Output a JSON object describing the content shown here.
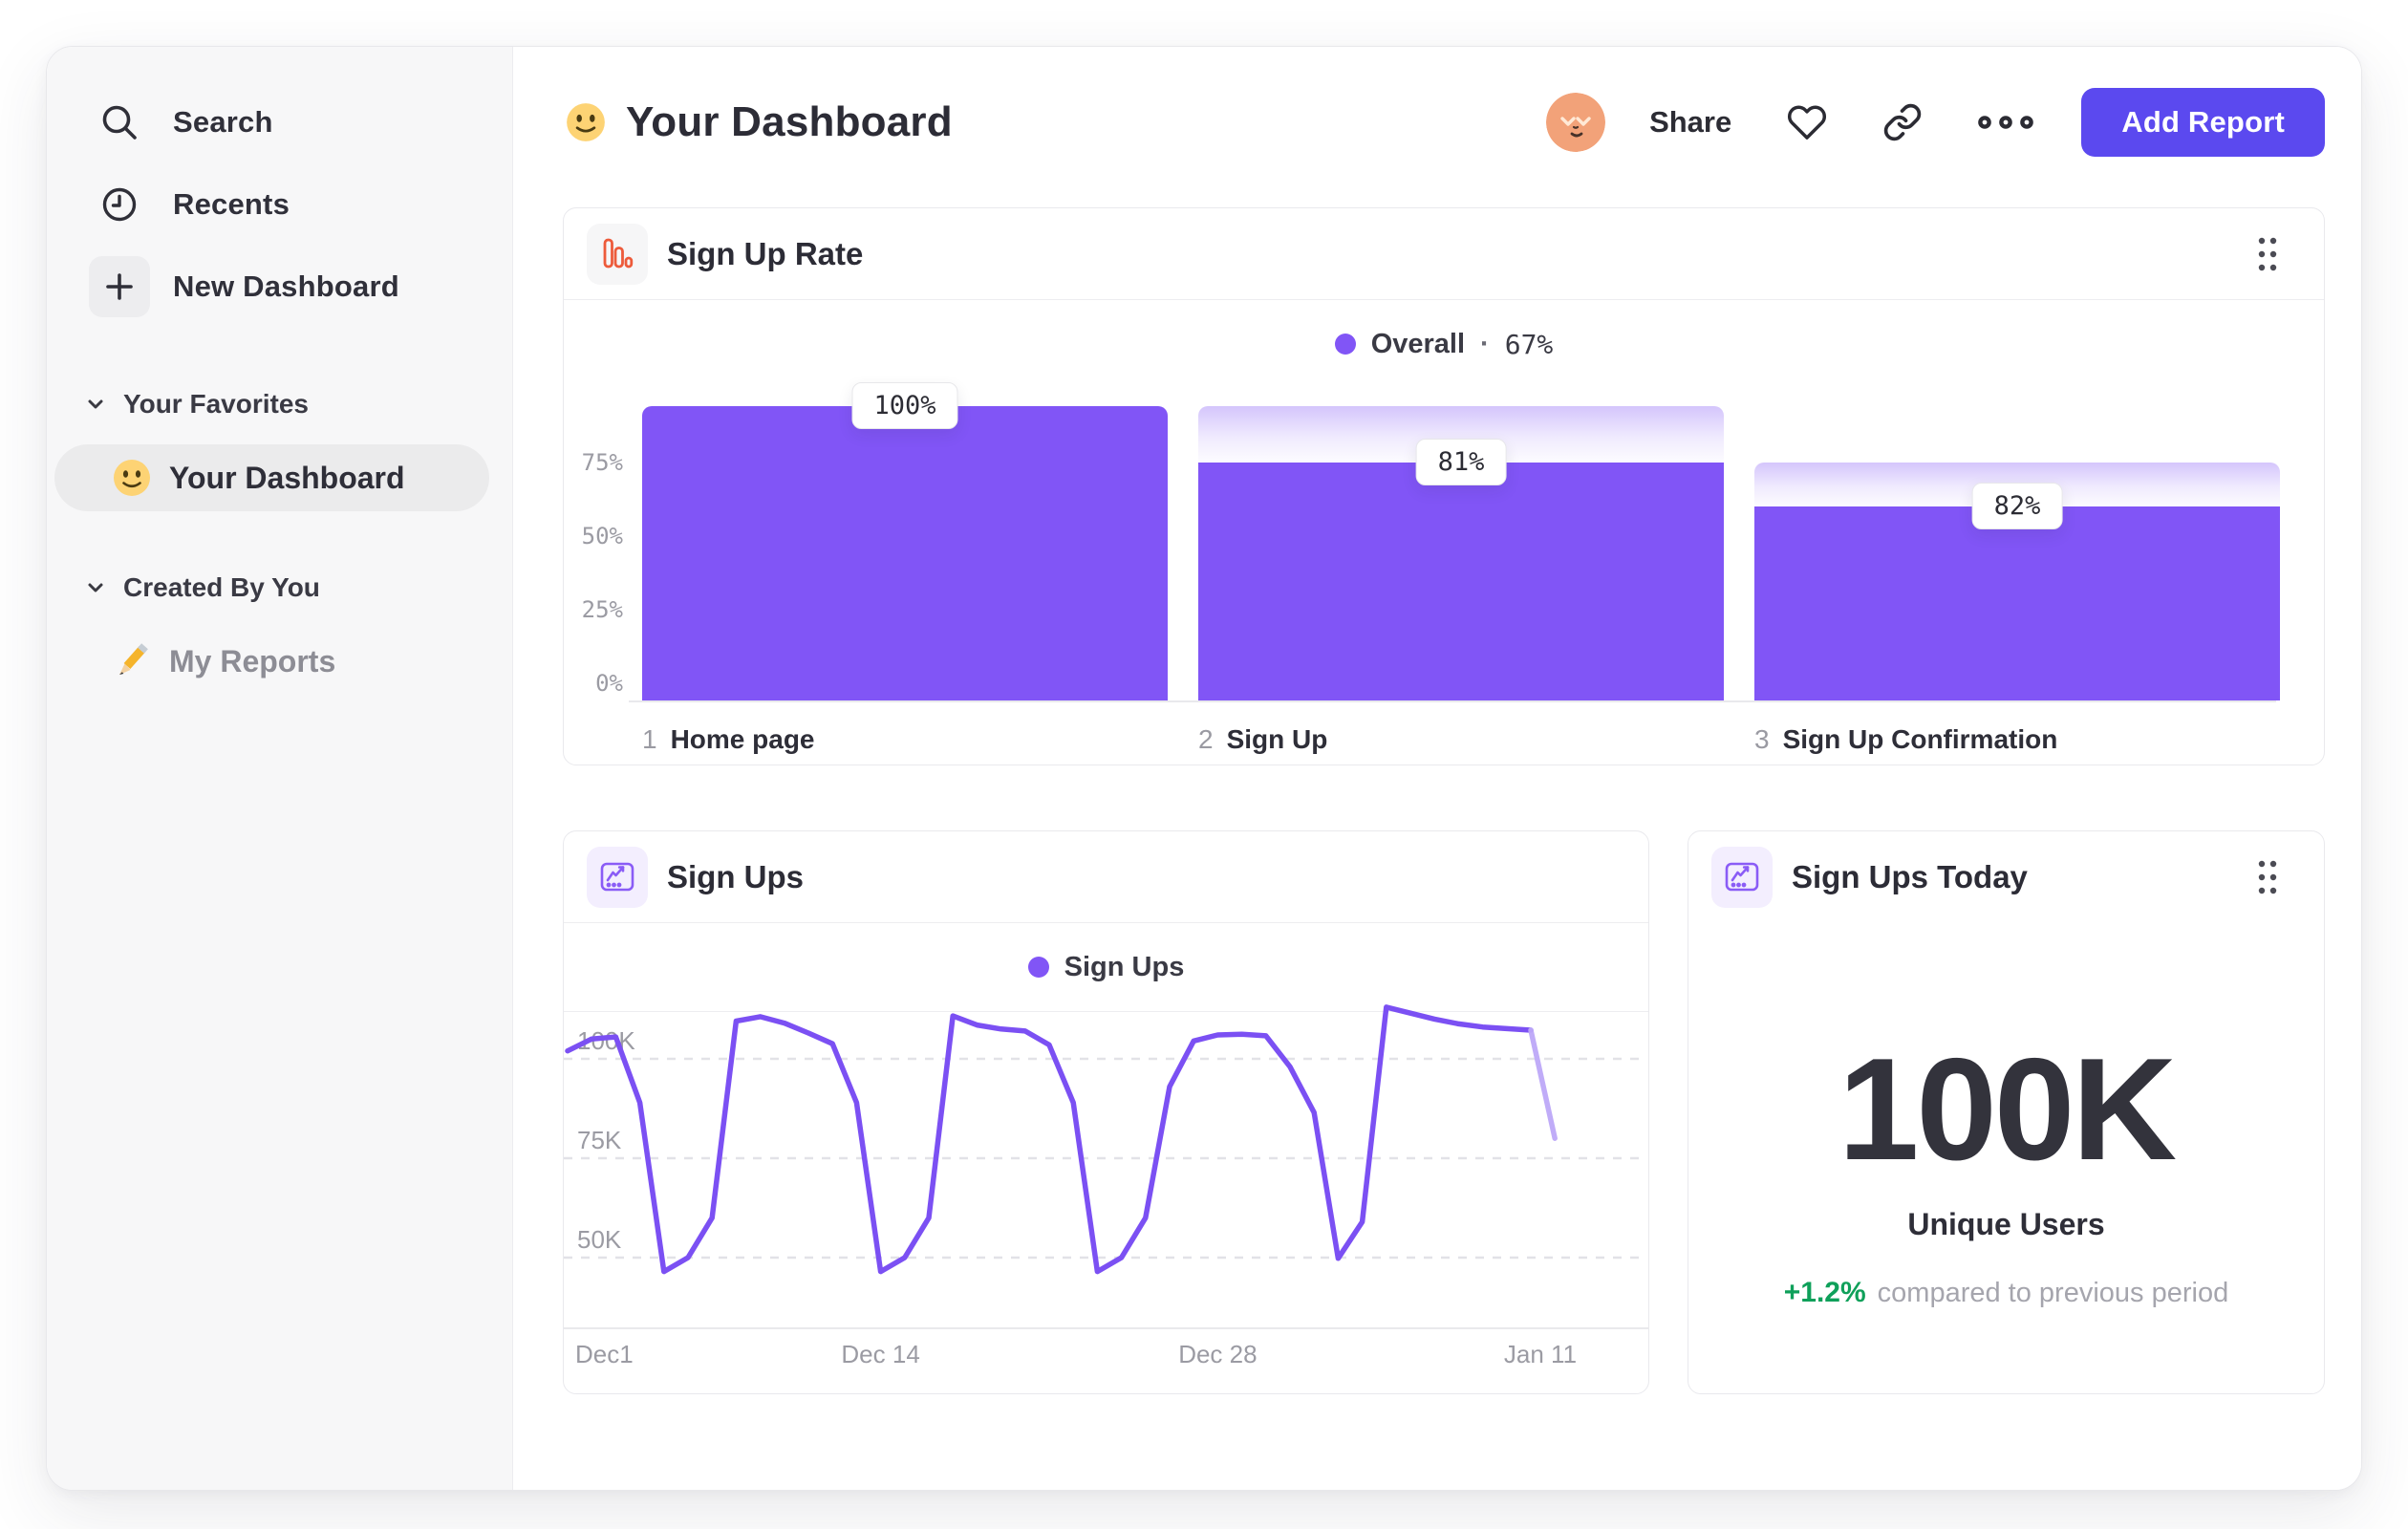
{
  "sidebar": {
    "nav": [
      {
        "icon": "search-icon",
        "label": "Search"
      },
      {
        "icon": "clock-icon",
        "label": "Recents"
      },
      {
        "icon": "plus-icon",
        "label": "New Dashboard"
      }
    ],
    "sections": [
      {
        "title": "Your Favorites",
        "items": [
          {
            "emoji": "slightly-smiling-face",
            "label": "Your Dashboard",
            "selected": true
          }
        ]
      },
      {
        "title": "Created By You",
        "items": [
          {
            "emoji": "pencil",
            "label": "My Reports",
            "selected": false
          }
        ]
      }
    ]
  },
  "header": {
    "emoji": "slightly-smiling-face",
    "title": "Your Dashboard",
    "share_label": "Share",
    "add_report_label": "Add Report"
  },
  "colors": {
    "accent_purple": "#8155f6",
    "line_purple": "#7b50f3",
    "button_indigo": "#5b49ef",
    "icon_orange": "#ed5b3b",
    "positive_green": "#0fa05a"
  },
  "cards": {
    "funnel": {
      "title": "Sign Up Rate",
      "legend": {
        "label": "Overall",
        "sep": "·",
        "value": "67%"
      }
    },
    "line": {
      "title": "Sign Ups",
      "legend": {
        "label": "Sign Ups"
      }
    },
    "kpi": {
      "title": "Sign Ups Today",
      "value": "100K",
      "label": "Unique Users",
      "delta": "+1.2%",
      "delta_text": "compared to previous period"
    }
  },
  "chart_data": [
    {
      "type": "bar",
      "subtype": "funnel",
      "title": "Sign Up Rate",
      "legend": "Overall · 67%",
      "ylim": [
        0,
        100
      ],
      "yticks": [
        {
          "label": "75%",
          "value": 75
        },
        {
          "label": "50%",
          "value": 50
        },
        {
          "label": "25%",
          "value": 25
        },
        {
          "label": "0%",
          "value": 0
        }
      ],
      "steps": [
        {
          "index": "1",
          "label": "Home page",
          "conversion_label": "100%",
          "conversion_pct": 100,
          "cumulative_pct": 100
        },
        {
          "index": "2",
          "label": "Sign Up",
          "conversion_label": "81%",
          "conversion_pct": 81,
          "cumulative_pct": 81
        },
        {
          "index": "3",
          "label": "Sign Up Confirmation",
          "conversion_label": "82%",
          "conversion_pct": 82,
          "cumulative_pct": 66
        }
      ]
    },
    {
      "type": "line",
      "title": "Sign Ups",
      "legend": "Sign Ups",
      "unit": "K",
      "ylim": [
        40,
        115
      ],
      "grid": "dashed-horizontal",
      "yticks": [
        {
          "label": "100K",
          "value": 100
        },
        {
          "label": "75K",
          "value": 75
        },
        {
          "label": "50K",
          "value": 50
        }
      ],
      "xticks": [
        {
          "label": "Dec1",
          "day": 0
        },
        {
          "label": "Dec 14",
          "day": 13
        },
        {
          "label": "Dec 28",
          "day": 27
        },
        {
          "label": "Jan 11",
          "day": 41
        }
      ],
      "x_range_days": 41,
      "faded_tail_segments": 1,
      "values": [
        102,
        105,
        105.5,
        89,
        46.5,
        50,
        60,
        109.5,
        110.6,
        109,
        106.5,
        103.8,
        89,
        46.5,
        50,
        60,
        110.8,
        108.5,
        107.5,
        107,
        103.5,
        89,
        46.5,
        50,
        60,
        93,
        104.5,
        106,
        106.2,
        105.8,
        98,
        86.5,
        49.8,
        59,
        113,
        111.5,
        110,
        108.8,
        108,
        107.6,
        107.2,
        80
      ]
    },
    {
      "type": "kpi",
      "title": "Sign Ups Today",
      "value": "100K",
      "label": "Unique Users",
      "delta": "+1.2%",
      "delta_text": "compared to previous period"
    }
  ]
}
